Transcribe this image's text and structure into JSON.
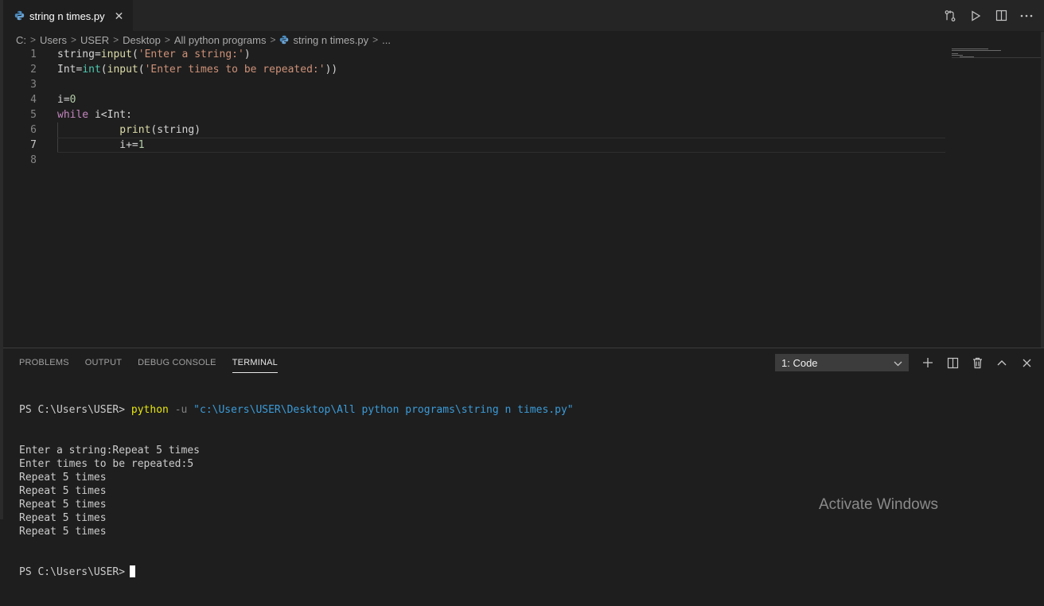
{
  "tab": {
    "title": "string n times.py",
    "icon": "python-file-icon",
    "close_symbol": "✕"
  },
  "breadcrumb": [
    "C:",
    "Users",
    "USER",
    "Desktop",
    "All python programs",
    "string n times.py",
    "..."
  ],
  "editor": {
    "active_line": 7,
    "lines": [
      {
        "n": "1",
        "tokens": [
          {
            "t": "string=",
            "c": ""
          },
          {
            "t": "input",
            "c": "fn"
          },
          {
            "t": "(",
            "c": ""
          },
          {
            "t": "'Enter a string:'",
            "c": "str"
          },
          {
            "t": ")",
            "c": ""
          }
        ]
      },
      {
        "n": "2",
        "tokens": [
          {
            "t": "Int=",
            "c": ""
          },
          {
            "t": "int",
            "c": "builtin"
          },
          {
            "t": "(",
            "c": ""
          },
          {
            "t": "input",
            "c": "fn"
          },
          {
            "t": "(",
            "c": ""
          },
          {
            "t": "'Enter times to be repeated:'",
            "c": "str"
          },
          {
            "t": "))",
            "c": ""
          }
        ]
      },
      {
        "n": "3",
        "tokens": []
      },
      {
        "n": "4",
        "tokens": [
          {
            "t": "i=",
            "c": ""
          },
          {
            "t": "0",
            "c": "num"
          }
        ]
      },
      {
        "n": "5",
        "tokens": [
          {
            "t": "while",
            "c": "kw"
          },
          {
            "t": " i<Int:",
            "c": ""
          }
        ]
      },
      {
        "n": "6",
        "tokens": [
          {
            "t": "          ",
            "c": ""
          },
          {
            "t": "print",
            "c": "fn"
          },
          {
            "t": "(string)",
            "c": ""
          }
        ]
      },
      {
        "n": "7",
        "tokens": [
          {
            "t": "          i+=",
            "c": ""
          },
          {
            "t": "1",
            "c": "num"
          }
        ]
      },
      {
        "n": "8",
        "tokens": []
      }
    ]
  },
  "panel": {
    "tabs": [
      "PROBLEMS",
      "OUTPUT",
      "DEBUG CONSOLE",
      "TERMINAL"
    ],
    "active_tab": "TERMINAL",
    "terminal_select": "1: Code"
  },
  "terminal": {
    "prompt": "PS C:\\Users\\USER>",
    "command": "python",
    "flag": "-u",
    "path": "\"c:\\Users\\USER\\Desktop\\All python programs\\string n times.py\"",
    "output": [
      "Enter a string:Repeat 5 times",
      "Enter times to be repeated:5",
      "Repeat 5 times",
      "Repeat 5 times",
      "Repeat 5 times",
      "Repeat 5 times",
      "Repeat 5 times"
    ],
    "final_prompt": "PS C:\\Users\\USER>"
  },
  "watermark": "Activate Windows"
}
